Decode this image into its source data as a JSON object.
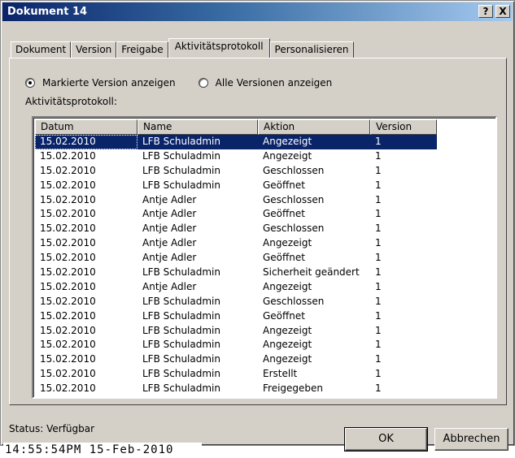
{
  "window": {
    "title": "Dokument 14",
    "help_button": "?",
    "close_button": "X"
  },
  "tabs": [
    "Dokument",
    "Version",
    "Freigabe",
    "Aktivitätsprotokoll",
    "Personalisieren"
  ],
  "active_tab": "Aktivitätsprotokoll",
  "radios": {
    "marked": "Markierte Version anzeigen",
    "all": "Alle Versionen anzeigen",
    "selected": "marked"
  },
  "list": {
    "caption": "Aktivitätsprotokoll:",
    "headers": [
      "Datum",
      "Name",
      "Aktion",
      "Version"
    ],
    "rows": [
      [
        "15.02.2010",
        "LFB Schuladmin",
        "Angezeigt",
        "1"
      ],
      [
        "15.02.2010",
        "LFB Schuladmin",
        "Angezeigt",
        "1"
      ],
      [
        "15.02.2010",
        "LFB Schuladmin",
        "Geschlossen",
        "1"
      ],
      [
        "15.02.2010",
        "LFB Schuladmin",
        "Geöffnet",
        "1"
      ],
      [
        "15.02.2010",
        "Antje Adler",
        "Geschlossen",
        "1"
      ],
      [
        "15.02.2010",
        "Antje Adler",
        "Geöffnet",
        "1"
      ],
      [
        "15.02.2010",
        "Antje Adler",
        "Geschlossen",
        "1"
      ],
      [
        "15.02.2010",
        "Antje Adler",
        "Angezeigt",
        "1"
      ],
      [
        "15.02.2010",
        "Antje Adler",
        "Geöffnet",
        "1"
      ],
      [
        "15.02.2010",
        "LFB Schuladmin",
        "Sicherheit geändert",
        "1"
      ],
      [
        "15.02.2010",
        "Antje Adler",
        "Angezeigt",
        "1"
      ],
      [
        "15.02.2010",
        "LFB Schuladmin",
        "Geschlossen",
        "1"
      ],
      [
        "15.02.2010",
        "LFB Schuladmin",
        "Geöffnet",
        "1"
      ],
      [
        "15.02.2010",
        "LFB Schuladmin",
        "Angezeigt",
        "1"
      ],
      [
        "15.02.2010",
        "LFB Schuladmin",
        "Angezeigt",
        "1"
      ],
      [
        "15.02.2010",
        "LFB Schuladmin",
        "Angezeigt",
        "1"
      ],
      [
        "15.02.2010",
        "LFB Schuladmin",
        "Erstellt",
        "1"
      ],
      [
        "15.02.2010",
        "LFB Schuladmin",
        "Freigegeben",
        "1"
      ]
    ],
    "selected_row": 0
  },
  "status": "Status: Verfügbar",
  "buttons": {
    "ok": "OK",
    "cancel": "Abbrechen"
  },
  "timestamp": "14:55:54PM 15-Feb-2010",
  "colors": {
    "title_start": "#0a246a",
    "title_end": "#a6caf0",
    "selection": "#0a246a",
    "face": "#d4d0c8"
  }
}
